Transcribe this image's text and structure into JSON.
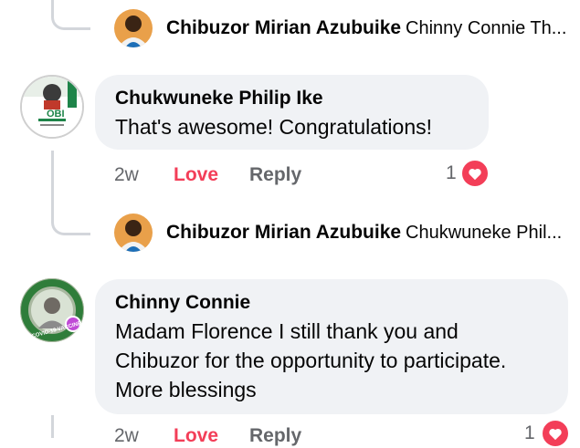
{
  "reply_preview_1": {
    "author": "Chibuzor Mirian Azubuike",
    "snippet": "Chinny Connie Th..."
  },
  "comment_1": {
    "author": "Chukwuneke Philip Ike",
    "text": "That's awesome! Congratulations!",
    "time": "2w",
    "love_label": "Love",
    "reply_label": "Reply",
    "reaction_count": "1",
    "reaction_icon": "heart-icon",
    "avatar_badge_text": "OBI"
  },
  "reply_preview_2": {
    "author": "Chibuzor Mirian Azubuike",
    "snippet": "Chukwuneke Phil..."
  },
  "comment_2": {
    "author": "Chinny Connie",
    "text": "Madam Florence I still thank you and Chibuzor for the opportunity to participate. More blessings",
    "time": "2w",
    "love_label": "Love",
    "reply_label": "Reply",
    "reaction_count": "1",
    "reaction_icon": "heart-icon",
    "avatar_frame_text": "COVID-19 VACCINE"
  },
  "colors": {
    "love": "#f33e58",
    "meta": "#65676b",
    "bubble": "#f0f2f5",
    "thread_line": "#d3d6db"
  }
}
